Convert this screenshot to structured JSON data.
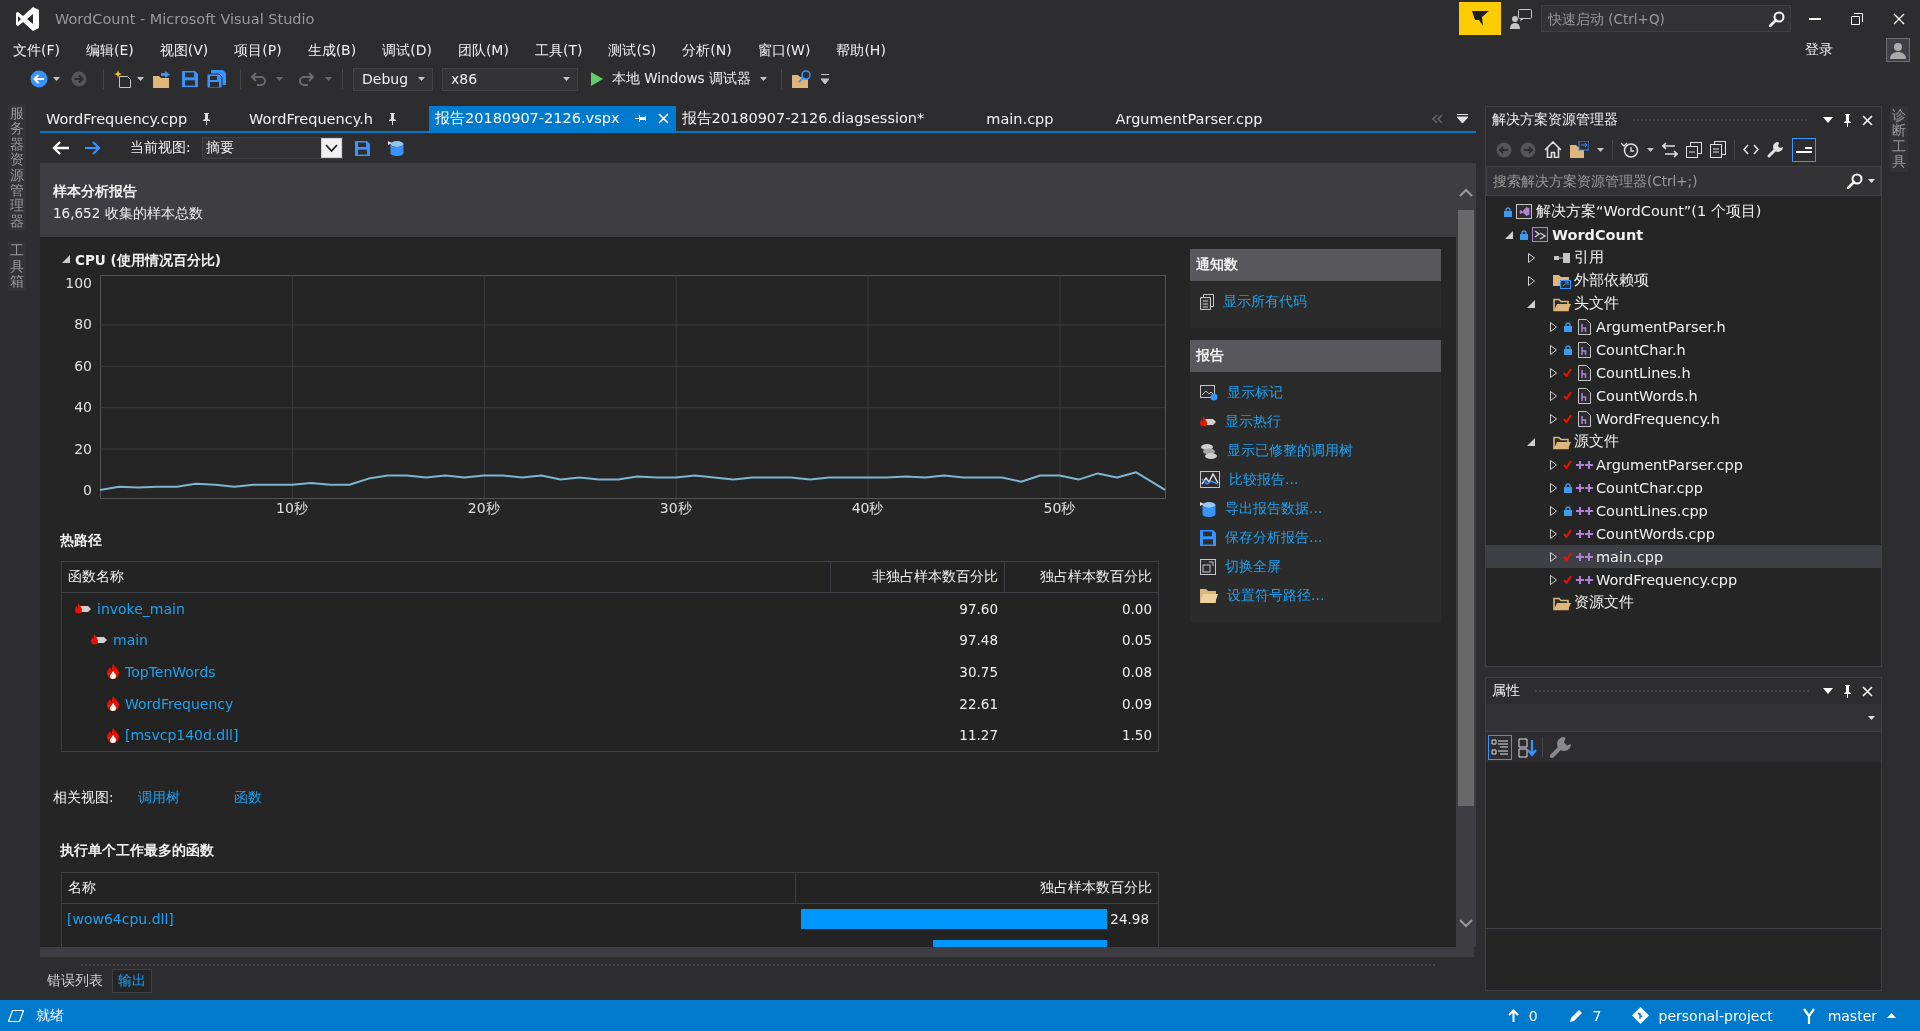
{
  "window": {
    "title": "WordCount - Microsoft Visual Studio",
    "quick_launch": {
      "placeholder": "快速启动 (Ctrl+Q)"
    },
    "sign_in": "登录"
  },
  "menu": [
    "文件(F)",
    "编辑(E)",
    "视图(V)",
    "项目(P)",
    "生成(B)",
    "调试(D)",
    "团队(M)",
    "工具(T)",
    "测试(S)",
    "分析(N)",
    "窗口(W)",
    "帮助(H)"
  ],
  "toolbar": {
    "configuration": "Debug",
    "platform": "x86",
    "start": "本地 Windows 调试器"
  },
  "side_tabs_left": [
    "服务器资源管理器",
    "工具箱"
  ],
  "side_tabs_right": [
    "诊断工具"
  ],
  "document_tabs": [
    {
      "label": "WordFrequency.cpp",
      "pinned": true,
      "selected": false
    },
    {
      "label": "WordFrequency.h",
      "pinned": true,
      "selected": false
    },
    {
      "label": "报告20180907-2126.vspx",
      "pinned": false,
      "selected": true
    },
    {
      "label": "报告20180907-2126.diagsession*",
      "pinned": false,
      "selected": false
    },
    {
      "label": "main.cpp",
      "pinned": false,
      "selected": false
    },
    {
      "label": "ArgumentParser.cpp",
      "pinned": false,
      "selected": false
    }
  ],
  "report": {
    "view_label": "当前视图:",
    "view": "摘要",
    "title": "样本分析报告",
    "subtitle": "16,652 收集的样本总数",
    "cpu": {
      "title": "CPU (使用情况百分比)",
      "expanded": true,
      "chart_data": {
        "type": "line",
        "x": [
          0,
          1,
          2,
          3,
          4,
          5,
          6,
          7,
          8,
          9,
          10,
          11,
          12,
          13,
          14,
          15,
          16,
          17,
          18,
          19,
          20,
          21,
          22,
          23,
          24,
          25,
          26,
          27,
          28,
          29,
          30,
          31,
          32,
          33,
          34,
          35,
          36,
          37,
          38,
          39,
          40,
          41,
          42,
          43,
          44,
          45,
          46,
          47,
          48,
          49,
          50,
          51,
          52,
          53,
          54,
          55.5
        ],
        "series": [
          {
            "color": "#7eb6d1",
            "values": [
              0,
              1.5,
              1.2,
              1.5,
              1.5,
              3,
              2.5,
              1.5,
              2.5,
              2.5,
              2.5,
              3.3,
              2.5,
              2.5,
              5.5,
              7,
              7,
              6,
              7,
              6,
              7,
              7,
              6,
              7,
              5,
              6,
              5,
              5,
              6.5,
              6,
              6,
              7,
              6,
              5,
              6,
              6,
              6,
              5,
              6,
              6,
              6,
              6,
              6.5,
              6,
              7,
              6,
              6,
              6,
              4,
              7,
              7,
              5,
              8,
              6,
              8.5,
              0
            ]
          }
        ],
        "xlim": [
          0,
          55.5
        ],
        "ylim": [
          -3.9,
          103.9
        ],
        "xticks": [
          {
            "value": 10,
            "label": "10秒"
          },
          {
            "value": 20,
            "label": "20秒"
          },
          {
            "value": 30,
            "label": "30秒"
          },
          {
            "value": 40,
            "label": "40秒"
          },
          {
            "value": 50,
            "label": "50秒"
          }
        ],
        "yticks": [
          0,
          20,
          40,
          60,
          80,
          100
        ],
        "grid": true
      }
    },
    "hot_path": {
      "title": "热路径",
      "columns": [
        "函数名称",
        "非独占样本数百分比",
        "独占样本数百分比"
      ],
      "rows": [
        {
          "name": "invoke_main",
          "kind": "path",
          "inclusive": "97.60",
          "exclusive": "0.00",
          "children": [
            {
              "name": "main",
              "kind": "path",
              "inclusive": "97.48",
              "exclusive": "0.05",
              "children": [
                {
                  "name": "TopTenWords",
                  "kind": "hotspot",
                  "inclusive": "30.75",
                  "exclusive": "0.08"
                },
                {
                  "name": "WordFrequency",
                  "kind": "hotspot",
                  "inclusive": "22.61",
                  "exclusive": "0.09"
                },
                {
                  "name": "[msvcp140d.dll]",
                  "kind": "hotspot",
                  "inclusive": "11.27",
                  "exclusive": "1.50"
                }
              ]
            }
          ]
        }
      ]
    },
    "related_views": {
      "label": "相关视图:",
      "links": [
        "调用树",
        "函数"
      ]
    },
    "top_functions": {
      "title": "执行单个工作最多的函数",
      "columns": [
        "名称",
        "独占样本数百分比"
      ],
      "rows": [
        {
          "name": "[wow64cpu.dll]",
          "level": 1,
          "value": "24.98"
        },
        {
          "level": 0.57
        }
      ]
    },
    "panels": [
      {
        "title": "通知数",
        "links": [
          "显示所有代码"
        ]
      },
      {
        "title": "报告",
        "links": [
          "显示标记",
          "显示热行",
          "显示已修整的调用树",
          "比较报告...",
          "导出报告数据...",
          "保存分析报告...",
          "切换全屏",
          "设置符号路径..."
        ]
      }
    ]
  },
  "output_tabs": [
    {
      "label": "错误列表",
      "selected": false
    },
    {
      "label": "输出",
      "selected": true
    }
  ],
  "solution_explorer": {
    "title": "解决方案资源管理器",
    "search": {
      "placeholder": "搜索解决方案资源管理器(Ctrl+;)"
    },
    "preview_on": true,
    "tree": [
      {
        "label": "解决方案“WordCount”(1 个项目)",
        "kind": "solution",
        "modified": false,
        "selected": false,
        "children": [
          {
            "label": "WordCount",
            "kind": "project",
            "modified": false,
            "expanded": true,
            "selected": false,
            "children": [
              {
                "label": "引用",
                "kind": "references",
                "expanded": false,
                "selected": false
              },
              {
                "label": "外部依赖项",
                "kind": "dependencies",
                "expanded": false,
                "selected": false
              },
              {
                "label": "头文件",
                "kind": "folder",
                "expanded": true,
                "selected": false,
                "children": [
                  {
                    "label": "ArgumentParser.h",
                    "kind": "header",
                    "modified": false,
                    "expanded": false,
                    "selected": false
                  },
                  {
                    "label": "CountChar.h",
                    "kind": "header",
                    "modified": false,
                    "expanded": false,
                    "selected": false
                  },
                  {
                    "label": "CountLines.h",
                    "kind": "header",
                    "modified": true,
                    "expanded": false,
                    "selected": false
                  },
                  {
                    "label": "CountWords.h",
                    "kind": "header",
                    "modified": true,
                    "expanded": false,
                    "selected": false
                  },
                  {
                    "label": "WordFrequency.h",
                    "kind": "header",
                    "modified": true,
                    "expanded": false,
                    "selected": false
                  }
                ]
              },
              {
                "label": "源文件",
                "kind": "folder",
                "expanded": true,
                "selected": false,
                "children": [
                  {
                    "label": "ArgumentParser.cpp",
                    "kind": "source",
                    "modified": true,
                    "expanded": false,
                    "selected": false
                  },
                  {
                    "label": "CountChar.cpp",
                    "kind": "source",
                    "modified": false,
                    "expanded": false,
                    "selected": false
                  },
                  {
                    "label": "CountLines.cpp",
                    "kind": "source",
                    "modified": false,
                    "expanded": false,
                    "selected": false
                  },
                  {
                    "label": "CountWords.cpp",
                    "kind": "source",
                    "modified": true,
                    "expanded": false,
                    "selected": false
                  },
                  {
                    "label": "main.cpp",
                    "kind": "source",
                    "modified": true,
                    "expanded": false,
                    "selected": true
                  },
                  {
                    "label": "WordFrequency.cpp",
                    "kind": "source",
                    "modified": true,
                    "expanded": false,
                    "selected": false
                  }
                ]
              },
              {
                "label": "资源文件",
                "kind": "folder",
                "selected": false
              }
            ]
          }
        ]
      }
    ]
  },
  "properties": {
    "title": "属性",
    "view_buttons": [
      {
        "selected": true
      },
      {
        "selected": false
      }
    ]
  },
  "status_bar": {
    "text": "就绪",
    "outgoing": "0",
    "changes": "7",
    "repository": "personal-project",
    "branch": "master"
  }
}
